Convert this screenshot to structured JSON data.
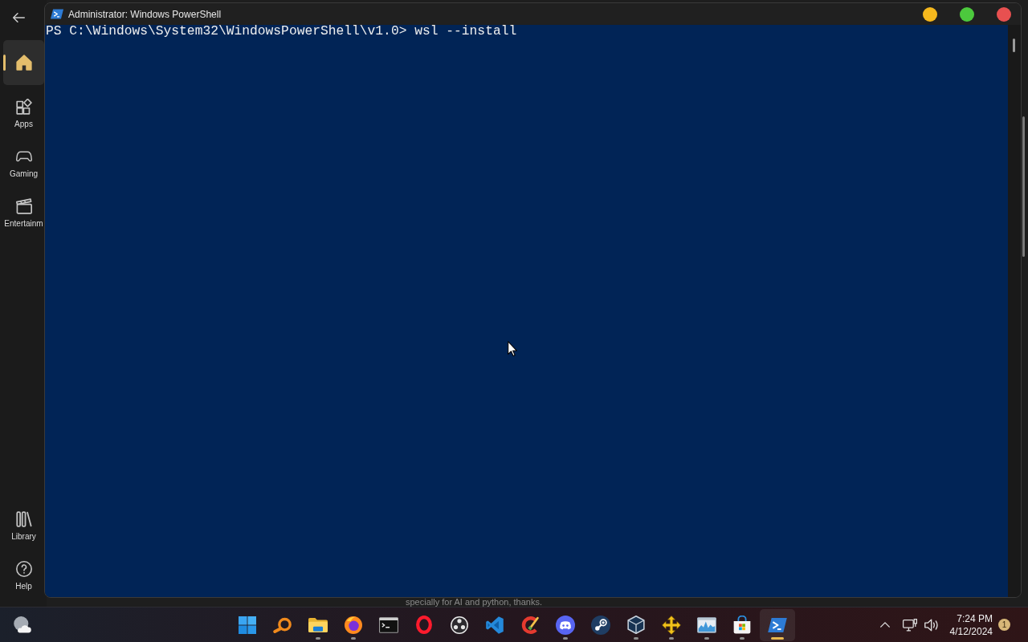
{
  "background_app": {
    "sidebar": {
      "items": [
        {
          "selected": true
        },
        {
          "label": "Apps",
          "selected": false
        },
        {
          "label": "Gaming",
          "selected": false
        },
        {
          "label": "Entertainm",
          "selected": false
        }
      ],
      "bottom_items": [
        {
          "label": "Library",
          "selected": false
        },
        {
          "label": "Help",
          "selected": false
        }
      ]
    },
    "caption": "specially for AI and python, thanks."
  },
  "window": {
    "title": "Administrator: Windows PowerShell",
    "lines": [
      "PS C:\\Windows\\System32\\WindowsPowerShell\\v1.0> wsl --install"
    ]
  },
  "taskbar": {
    "apps": [
      {
        "running": false,
        "selected": false
      },
      {
        "running": false,
        "selected": false
      },
      {
        "running": true,
        "selected": false
      },
      {
        "running": true,
        "selected": false
      },
      {
        "running": false,
        "selected": false
      },
      {
        "running": false,
        "selected": false
      },
      {
        "running": false,
        "selected": false
      },
      {
        "running": false,
        "selected": false
      },
      {
        "running": false,
        "selected": false
      },
      {
        "running": true,
        "selected": false
      },
      {
        "running": false,
        "selected": false
      },
      {
        "running": true,
        "selected": false
      },
      {
        "running": true,
        "selected": false
      },
      {
        "running": true,
        "selected": false
      },
      {
        "running": true,
        "selected": false
      },
      {
        "running": true,
        "selected": true
      }
    ],
    "clock": {
      "time": "7:24 PM",
      "date": "4/12/2024"
    },
    "notifications": "1"
  }
}
